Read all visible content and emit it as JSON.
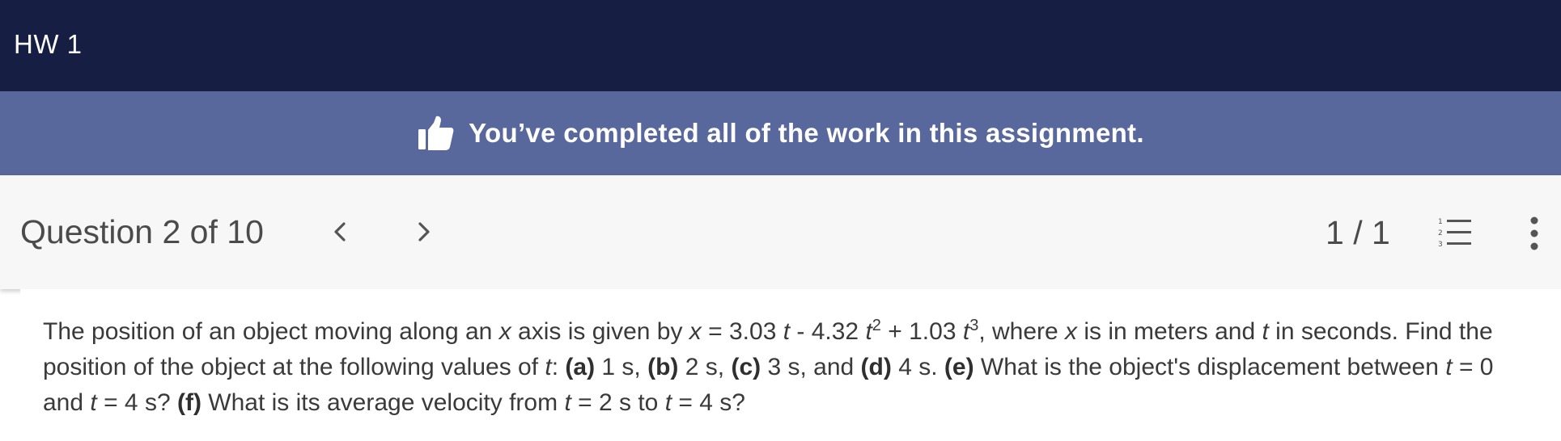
{
  "header": {
    "title": "HW 1"
  },
  "banner": {
    "icon": "thumbs-up-icon",
    "message": "You’ve completed all of the work in this assignment.",
    "background": "#58689c"
  },
  "question_bar": {
    "label": "Question 2 of 10",
    "prev_icon": "chevron-left-icon",
    "next_icon": "chevron-right-icon",
    "score": "1 / 1",
    "list_icon": "numbered-list-icon",
    "more_icon": "more-vertical-icon"
  },
  "question": {
    "line1": {
      "t1": "The position of an object moving along an ",
      "v1": "x",
      "t2": " axis is given by ",
      "v2": "x",
      "t3": " = 3.03 ",
      "v3": "t",
      "t4": " - 4.32 ",
      "v4": "t",
      "exp1": "2",
      "t5": " + 1.03 ",
      "v5": "t",
      "exp2": "3",
      "t6": ", where ",
      "v6": "x",
      "t7": " is in meters and ",
      "v7": "t",
      "t8": " in seconds. Find the"
    },
    "line2": {
      "t1": "position of the object at the following values of ",
      "v1": "t",
      "t2": ": ",
      "a": "(a)",
      "a_val": " 1 s, ",
      "b": "(b)",
      "b_val": " 2 s, ",
      "c": "(c)",
      "c_val": " 3 s, and ",
      "d": "(d)",
      "d_val": " 4 s. ",
      "e": "(e)",
      "e_text": " What is the object's displacement between ",
      "v2": "t",
      "t3": " = 0"
    },
    "line3": {
      "t1": "and ",
      "v1": "t",
      "t2": " = 4 s? ",
      "f": "(f)",
      "f_text": " What is its average velocity from ",
      "v2": "t",
      "t3": " = 2 s to ",
      "v3": "t",
      "t4": " = 4 s?"
    }
  }
}
